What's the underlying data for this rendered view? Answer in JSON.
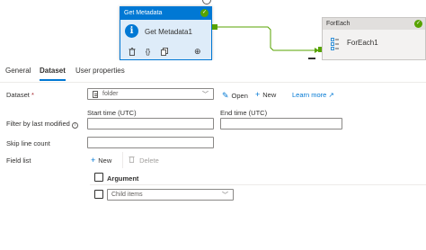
{
  "canvas": {
    "get_metadata": {
      "header": "Get Metadata",
      "name": "Get Metadata1",
      "status": "succeeded",
      "actions": [
        "delete-icon",
        "code-braces-icon",
        "copy-icon",
        "output-arrow-icon"
      ]
    },
    "foreach": {
      "header": "ForEach",
      "name": "ForEach1",
      "status": "succeeded"
    },
    "colors": {
      "accent": "#0078d4",
      "success": "#57a300",
      "node_body": "#deecf9"
    }
  },
  "tabs": [
    {
      "label": "General",
      "active": false
    },
    {
      "label": "Dataset",
      "active": true
    },
    {
      "label": "User properties",
      "active": false
    }
  ],
  "form": {
    "dataset": {
      "label": "Dataset",
      "required_mark": "*",
      "value": "folder",
      "open_label": "Open",
      "new_label": "New",
      "learn_more_label": "Learn more"
    },
    "filter": {
      "label": "Filter by last modified",
      "start_label": "Start time (UTC)",
      "end_label": "End time (UTC)",
      "start_value": "",
      "end_value": ""
    },
    "skip_line_count": {
      "label": "Skip line count",
      "value": ""
    },
    "field_list": {
      "label": "Field list",
      "new_label": "New",
      "delete_label": "Delete",
      "column_header": "Argument",
      "rows": [
        {
          "value": "Child items"
        }
      ]
    }
  }
}
